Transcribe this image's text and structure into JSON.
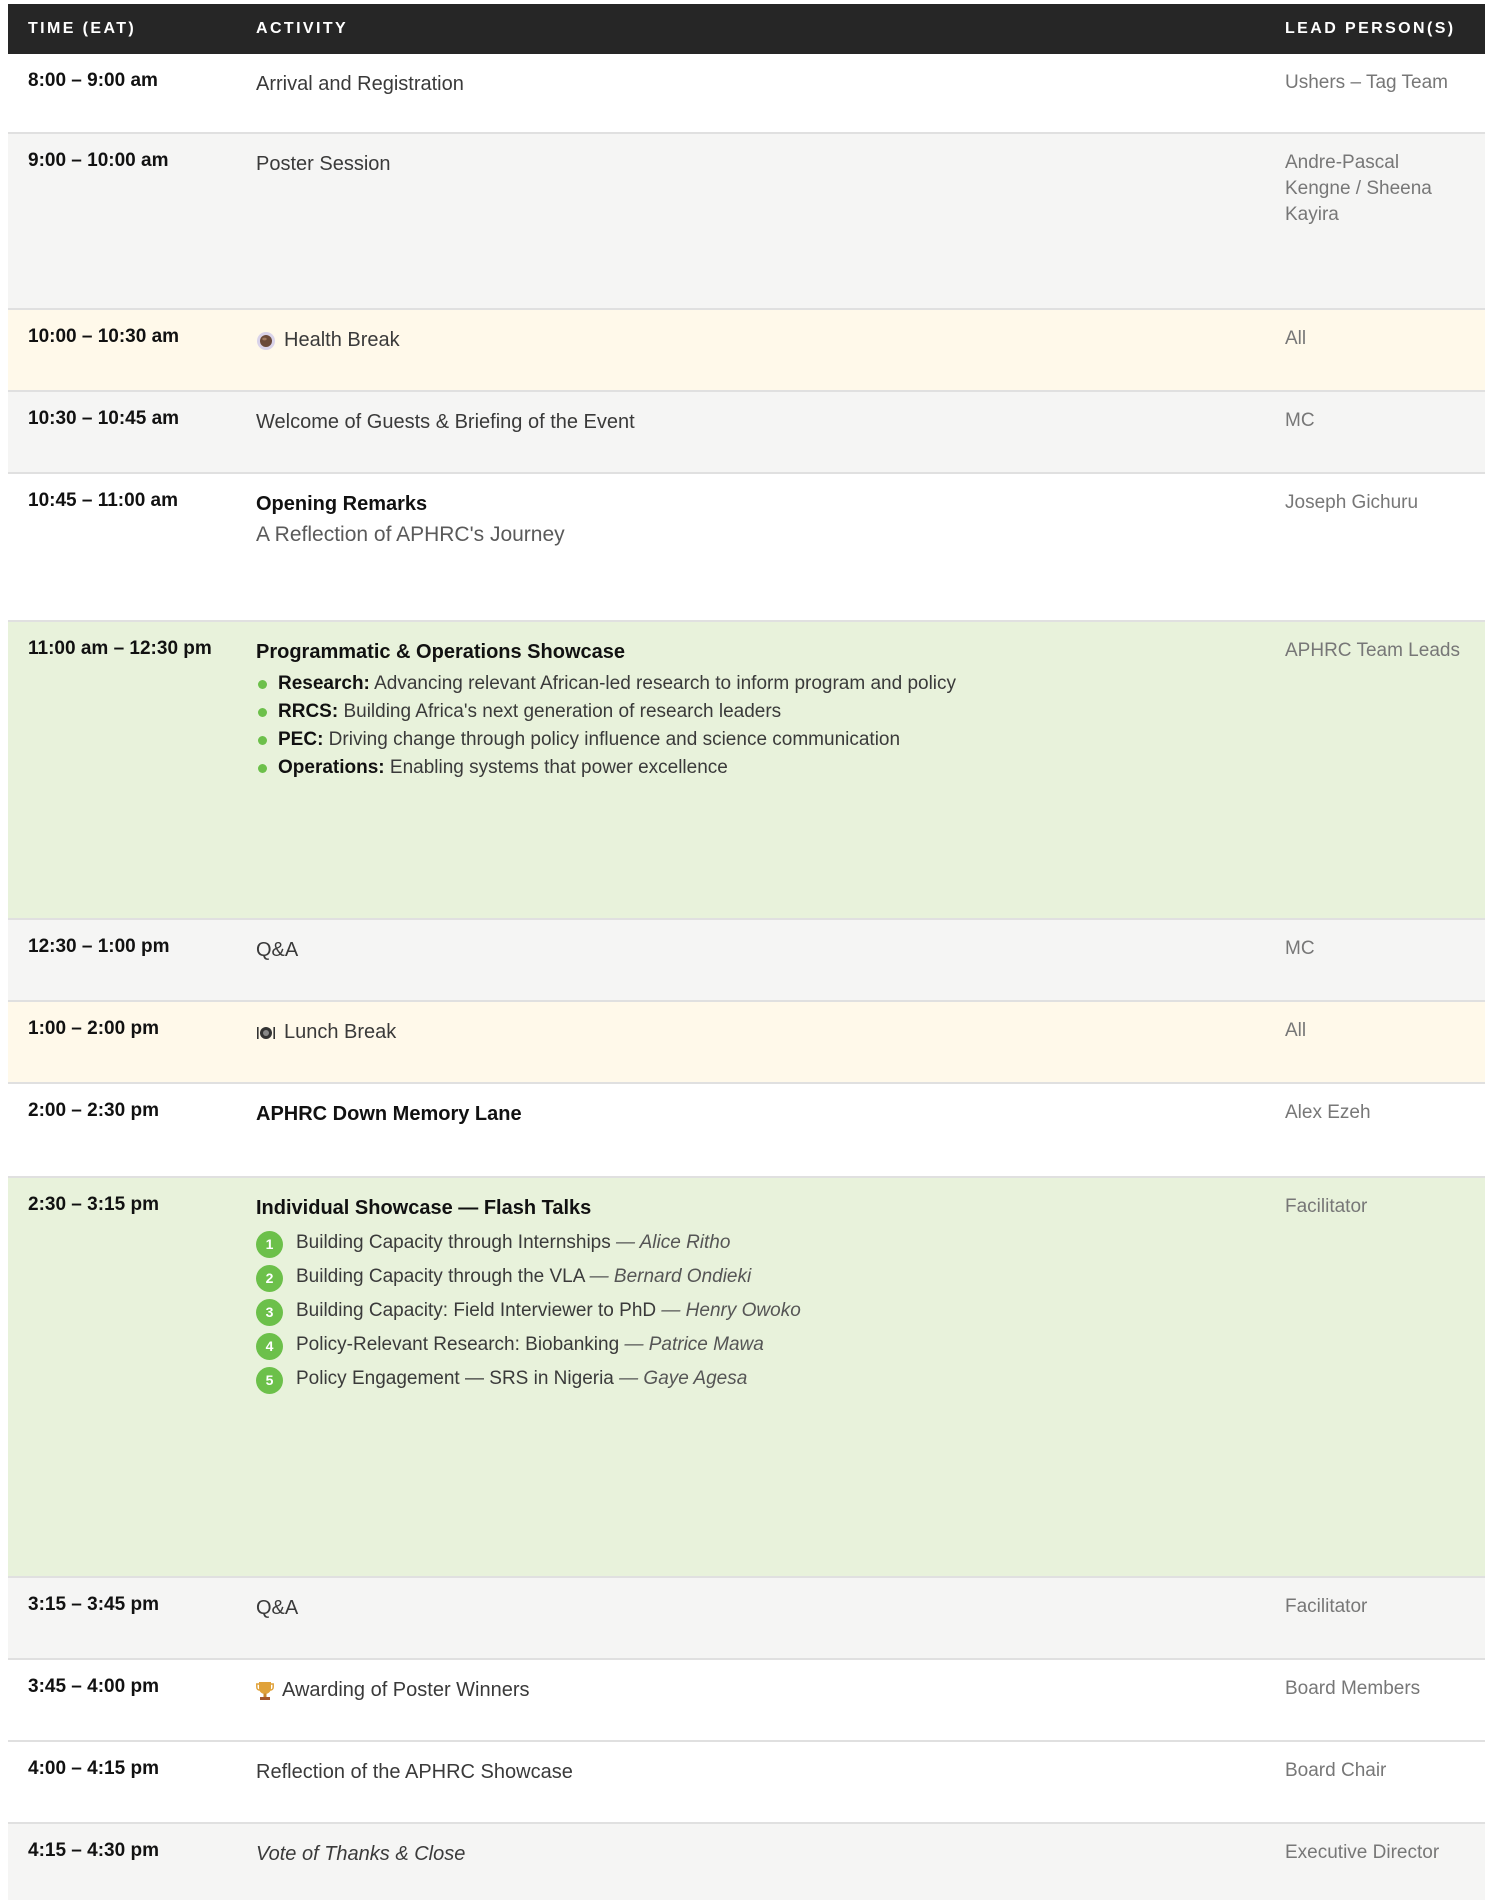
{
  "header": {
    "time": "TIME (EAT)",
    "activity": "ACTIVITY",
    "lead": "LEAD PERSON(S)"
  },
  "rows": [
    {
      "time": "8:00 – 9:00 am",
      "activity": "Arrival and Registration",
      "lead": "Ushers – Tag Team"
    },
    {
      "time": "9:00 – 10:00 am",
      "activity": "Poster Session",
      "lead": "Andre-Pascal Kengne / Sheena Kayira"
    },
    {
      "time": "10:00 – 10:30 am",
      "activity": "Health Break",
      "icon": "coffee-icon",
      "lead": "All"
    },
    {
      "time": "10:30 – 10:45 am",
      "activity": "Welcome of Guests & Briefing of the Event",
      "lead": "MC"
    },
    {
      "time": "10:45 – 11:00 am",
      "activity": "Opening Remarks",
      "subtitle": "A Reflection of APHRC's Journey",
      "lead": "Joseph Gichuru"
    },
    {
      "time": "11:00 am – 12:30 pm",
      "activity": "Programmatic & Operations Showcase",
      "lead": "APHRC Team Leads",
      "bullets": [
        {
          "label": "Research:",
          "text": " Advancing relevant African-led research to inform program and policy"
        },
        {
          "label": "RRCS:",
          "text": " Building Africa's next generation of research leaders"
        },
        {
          "label": "PEC:",
          "text": " Driving change through policy influence and science communication"
        },
        {
          "label": "Operations:",
          "text": " Enabling systems that power excellence"
        }
      ]
    },
    {
      "time": "12:30 – 1:00 pm",
      "activity": "Q&A",
      "lead": "MC"
    },
    {
      "time": "1:00 – 2:00 pm",
      "activity": "Lunch Break",
      "icon": "plate-icon",
      "lead": "All"
    },
    {
      "time": "2:00 – 2:30 pm",
      "activity": "APHRC Down Memory Lane",
      "lead": "Alex Ezeh"
    },
    {
      "time": "2:30 – 3:15 pm",
      "activity": "Individual Showcase — Flash Talks",
      "lead": "Facilitator",
      "talks": [
        {
          "num": "1",
          "title": "Building Capacity through Internships",
          "speaker": "— Alice Ritho"
        },
        {
          "num": "2",
          "title": "Building Capacity through the VLA",
          "speaker": "— Bernard Ondieki"
        },
        {
          "num": "3",
          "title": "Building Capacity: Field Interviewer to PhD",
          "speaker": "— Henry Owoko"
        },
        {
          "num": "4",
          "title": "Policy-Relevant Research: Biobanking",
          "speaker": "— Patrice Mawa"
        },
        {
          "num": "5",
          "title": "Policy Engagement — SRS in Nigeria",
          "speaker": "— Gaye Agesa"
        }
      ]
    },
    {
      "time": "3:15 – 3:45 pm",
      "activity": "Q&A",
      "lead": "Facilitator"
    },
    {
      "time": "3:45 – 4:00 pm",
      "activity": "Awarding of Poster Winners",
      "icon": "trophy-icon",
      "lead": "Board Members"
    },
    {
      "time": "4:00 – 4:15 pm",
      "activity": "Reflection of the APHRC Showcase",
      "lead": "Board Chair"
    },
    {
      "time": "4:15 – 4:30 pm",
      "activity": "Vote of Thanks & Close",
      "lead": "Executive Director"
    }
  ]
}
